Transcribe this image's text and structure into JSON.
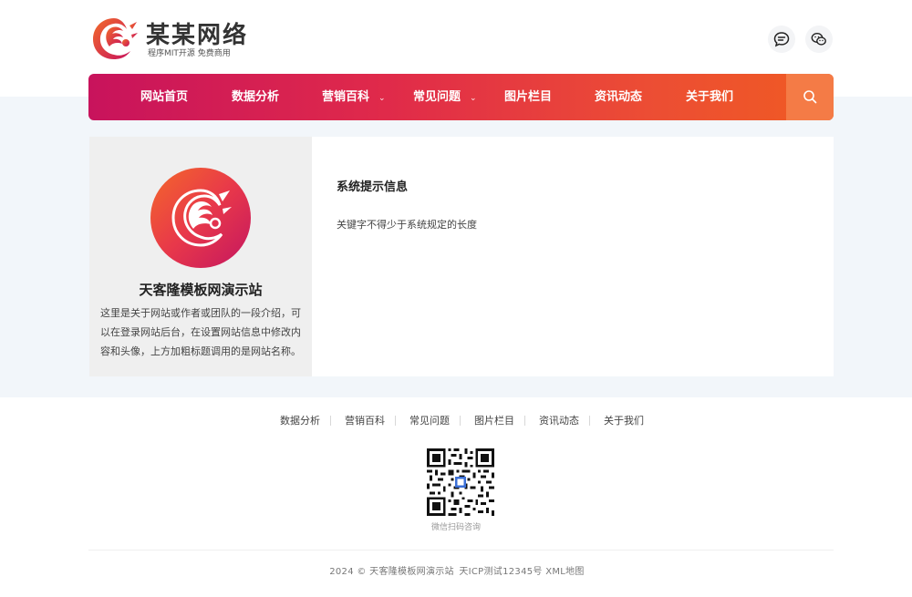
{
  "header": {
    "brand_name": "某某网络",
    "brand_tagline": "程序MIT开源 免费商用",
    "icons": [
      "chat-bubble-icon",
      "wechat-icon"
    ]
  },
  "nav": {
    "items": [
      {
        "label": "网站首页"
      },
      {
        "label": "数据分析"
      },
      {
        "label": "营销百科",
        "has_dropdown": true
      },
      {
        "label": "常见问题",
        "has_dropdown": true
      },
      {
        "label": "图片栏目"
      },
      {
        "label": "资讯动态"
      },
      {
        "label": "关于我们"
      }
    ],
    "search_icon": "search-icon"
  },
  "sidebar": {
    "site_name": "天客隆模板网演示站",
    "description": "这里是关于网站或作者或团队的一段介绍，可以在登录网站后台，在设置网站信息中修改内容和头像，上方加粗标题调用的是网站名称。"
  },
  "message": {
    "title": "系统提示信息",
    "text": "关键字不得少于系统规定的长度"
  },
  "footer": {
    "links": [
      "数据分析",
      "营销百科",
      "常见问题",
      "图片栏目",
      "资讯动态",
      "关于我们"
    ],
    "qr_caption": "微信扫码咨询",
    "copyright": {
      "year_text": "2024 © 天客隆模板网演示站",
      "icp": "天ICP测试12345号",
      "sitemap": "XML地图"
    }
  },
  "colors": {
    "nav_gradient_start": "#c8135c",
    "nav_gradient_end": "#f05b22",
    "search_bg": "#f47b46",
    "page_bg": "#f2f6fa"
  }
}
